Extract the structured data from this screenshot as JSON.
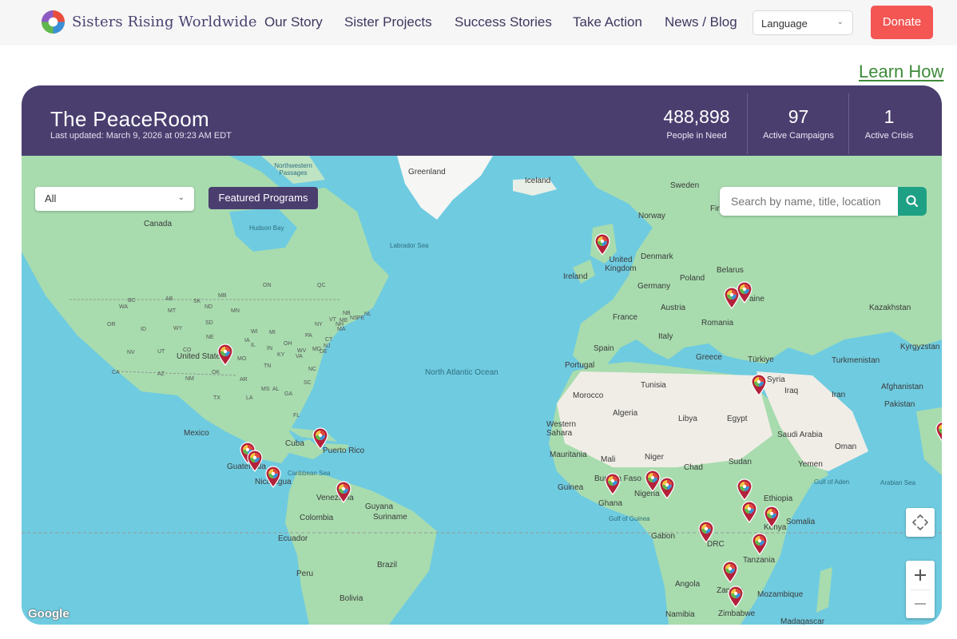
{
  "nav": {
    "logo_text": "Sisters Rising Worldwide",
    "links": [
      "Our Story",
      "Sister Projects",
      "Success Stories",
      "Take Action",
      "News / Blog"
    ],
    "language_label": "Language",
    "donate_label": "Donate"
  },
  "learn_how": "Learn How",
  "peaceroom": {
    "title": "The PeaceRoom",
    "updated": "Last updated: March 9, 2026 at 09:23 AM EDT",
    "stats": [
      {
        "value": "488,898",
        "label": "People in Need"
      },
      {
        "value": "97",
        "label": "Active Campaigns"
      },
      {
        "value": "1",
        "label": "Active Crisis"
      }
    ]
  },
  "map": {
    "filter_value": "All",
    "featured_label": "Featured Programs",
    "search_placeholder": "Search by name, title, location",
    "attribution": "Google",
    "labels": {
      "greenland": "Greenland",
      "iceland": "Iceland",
      "sweden": "Sweden",
      "norway": "Norway",
      "finland": "Fin",
      "canada": "Canada",
      "hudson": "Hudson Bay",
      "nw_passages": "Northwestern Passages",
      "labrador": "Labrador Sea",
      "united_kingdom": "United Kingdom",
      "ireland": "Ireland",
      "denmark": "Denmark",
      "belarus": "Belarus",
      "poland": "Poland",
      "germany": "Germany",
      "ukraine": "aine",
      "kazakhstan": "Kazakhstan",
      "france": "France",
      "austria": "Austria",
      "romania": "Romania",
      "italy": "Italy",
      "spain": "Spain",
      "portugal": "Portugal",
      "greece": "Greece",
      "turkiye": "Türkiye",
      "kyrgyzstan": "Kyrgyzstan",
      "turkmenistan": "Turkmenistan",
      "syria": "Syria",
      "iraq": "Iraq",
      "iran": "Iran",
      "afghanistan": "Afghanistan",
      "pakistan": "Pakistan",
      "united_states": "United States",
      "north_atlantic": "North Atlantic Ocean",
      "tunisia": "Tunisia",
      "morocco": "Morocco",
      "algeria": "Algeria",
      "libya": "Libya",
      "egypt": "Egypt",
      "western_sahara": "Western Sahara",
      "saudi_arabia": "Saudi Arabia",
      "oman": "Oman",
      "mexico": "Mexico",
      "cuba": "Cuba",
      "puerto_rico": "Puerto Rico",
      "guatemala": "Guatemala",
      "nicaragua": "Nicaragua",
      "caribbean": "Caribbean Sea",
      "venezuela": "Venezuela",
      "guyana": "Guyana",
      "suriname": "Suriname",
      "colombia": "Colombia",
      "ecuador": "Ecuador",
      "peru": "Peru",
      "brazil": "Brazil",
      "bolivia": "Bolivia",
      "mauritania": "Mauritania",
      "mali": "Mali",
      "niger": "Niger",
      "chad": "Chad",
      "sudan": "Sudan",
      "yemen": "Yemen",
      "gulf_aden": "Gulf of Aden",
      "arabian_sea": "Arabian Sea",
      "burkina": "Burkina Faso",
      "guinea": "Guinea",
      "ghana": "Ghana",
      "nigeria": "Nigeria",
      "ethiopia": "Ethiopia",
      "gulf_guinea": "Gulf of Guinea",
      "somalia": "Somalia",
      "gabon": "Gabon",
      "drc": "DRC",
      "kenya": "Kenya",
      "tanzania": "Tanzania",
      "angola": "Angola",
      "zambia": "Zambia",
      "mozambique": "Mozambique",
      "namibia": "Namibia",
      "zimbabwe": "Zimbabwe",
      "madagascar": "Madagascar",
      "states": [
        "WA",
        "MT",
        "ND",
        "MN",
        "SD",
        "OR",
        "ID",
        "WY",
        "NE",
        "IA",
        "NV",
        "UT",
        "CO",
        "KS",
        "MO",
        "IL",
        "IN",
        "OH",
        "PA",
        "NY",
        "CA",
        "AZ",
        "NM",
        "OK",
        "AR",
        "TN",
        "KY",
        "VA",
        "TX",
        "LA",
        "MS",
        "AL",
        "GA",
        "SC",
        "NC",
        "FL",
        "WI",
        "MI",
        "ON",
        "QC",
        "NB",
        "NS",
        "PE",
        "NL",
        "ME",
        "VT",
        "NH",
        "MA",
        "CT",
        "NJ",
        "DE",
        "MD",
        "WV",
        "SK",
        "MB",
        "AB",
        "BC"
      ]
    }
  },
  "colors": {
    "nav_bg": "#f6f6f7",
    "brand_purple": "#4a3e6f",
    "donate": "#f35653",
    "learn_how": "#3d8b3a",
    "search_btn": "#1ea085",
    "water": "#6fcbe0",
    "land": "#a8dcae",
    "desert": "#f0ede6"
  }
}
